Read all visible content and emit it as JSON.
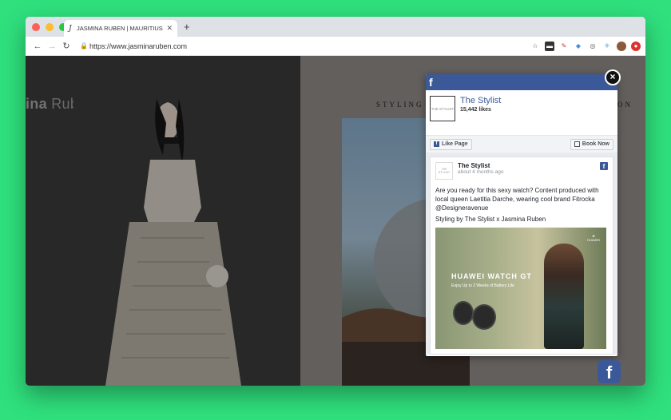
{
  "browser": {
    "tab_title": "JASMINA RUBEN | MAURITIUS",
    "tab_close": "✕",
    "new_tab": "+",
    "url": "https://www.jasminaruben.com",
    "colors": {
      "red": "#fe5f57",
      "yellow": "#febc2e",
      "green": "#28c840"
    }
  },
  "site": {
    "title_bold": "ina",
    "title_rest": " Ruben",
    "styling_text": "STYLING",
    "right_text": "ON"
  },
  "fb": {
    "page_logo_text": "THE STYLIST",
    "page_name": "The Stylist",
    "page_likes": "15,442 likes",
    "like_page": "Like Page",
    "book_now": "Book Now",
    "post": {
      "author": "The Stylist",
      "time": "about 4 months ago",
      "text1": "Are you ready for this sexy watch? Content produced with local queen Laetitia Darche, wearing cool brand Fitrocka @Designeravenue",
      "text2": "Styling by The Stylist x Jasmina Ruben",
      "ad_brand": "HUAWEI WATCH GT",
      "ad_sub": "Enjoy Up to 2 Weeks of Battery Life",
      "ad_logo": "HUAWEI"
    },
    "close": "×"
  }
}
